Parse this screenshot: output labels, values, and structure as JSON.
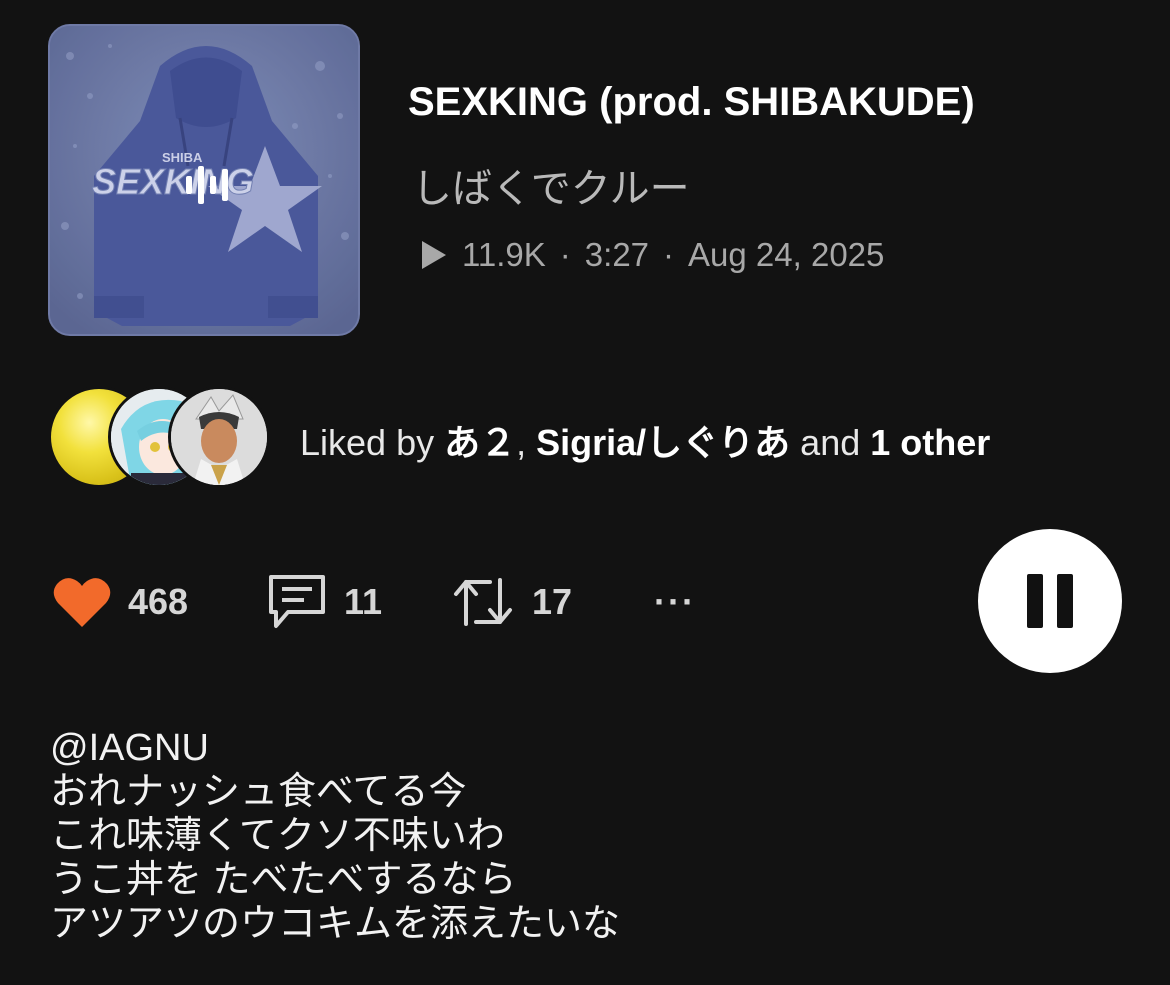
{
  "artwork": {
    "label": "SEXKING",
    "sublabel": "SHIBA"
  },
  "track": {
    "title": "SEXKING (prod. SHIBAKUDE)",
    "artist": "しばくでクルー",
    "plays": "11.9K",
    "separator": "·",
    "duration": "3:27",
    "date": "Aug 24, 2025"
  },
  "likes": {
    "prefix": "Liked by ",
    "user1": "あ２",
    "comma": ", ",
    "user2": "Sigria/しぐりあ",
    "and": " and ",
    "others": "1 other"
  },
  "actions": {
    "likes_count": "468",
    "comments_count": "11",
    "reposts_count": "17",
    "more_label": "···"
  },
  "description": {
    "lines": [
      "@IAGNU",
      "おれナッシュ食べてる今",
      "これ味薄くてクソ不味いわ",
      "うこ丼を たべたべするなら",
      "アツアツのウコキムを添えたいな"
    ]
  },
  "colors": {
    "background": "#121212",
    "like": "#f26a2b",
    "artwork": "#5b6898"
  }
}
